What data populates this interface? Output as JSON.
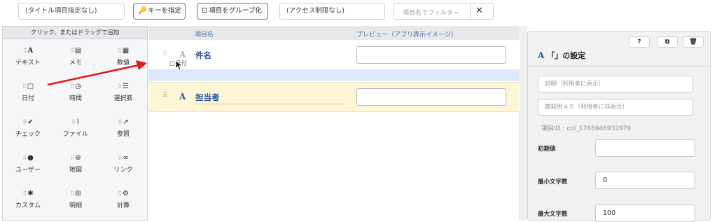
{
  "toolbar": {
    "title_field": "(タイトル項目指定なし)",
    "key_button": "キーを指定",
    "group_button": "項目をグループ化",
    "access_field": "(アクセス制限なし)",
    "filter_placeholder": "項目名でフィルター"
  },
  "palette": {
    "header": "クリック、またはドラッグで追加",
    "items": [
      {
        "label": "テキスト",
        "icon": "A"
      },
      {
        "label": "メモ",
        "icon": "▤"
      },
      {
        "label": "数値",
        "icon": "▦"
      },
      {
        "label": "日付",
        "icon": "▢"
      },
      {
        "label": "時間",
        "icon": "◷"
      },
      {
        "label": "選択肢",
        "icon": "☰"
      },
      {
        "label": "チェック",
        "icon": "✔"
      },
      {
        "label": "ファイル",
        "icon": "⌇"
      },
      {
        "label": "参照",
        "icon": "↗"
      },
      {
        "label": "ユーザー",
        "icon": "●"
      },
      {
        "label": "地図",
        "icon": "⊕"
      },
      {
        "label": "リンク",
        "icon": "∞"
      },
      {
        "label": "カスタム",
        "icon": "✱"
      },
      {
        "label": "明細",
        "icon": "⊞"
      },
      {
        "label": "計算",
        "icon": "⚙"
      }
    ]
  },
  "list": {
    "col_name": "項目名",
    "col_preview": "プレビュー（アプリ表示イメージ）",
    "fields": [
      {
        "type_icon": "A",
        "name": "件名"
      },
      {
        "type_icon": "A",
        "name": "担当者"
      }
    ],
    "drag_ghost_label": "日付"
  },
  "settings": {
    "title": "「」の設定",
    "type_icon": "A",
    "buttons": [
      "?",
      "⧉",
      "🗑"
    ],
    "description_placeholder": "説明（利用者に表示）",
    "dev_memo_placeholder": "開発用メモ（利用者に非表示）",
    "field_id": "項目ID : col_1765946931979",
    "initial_label": "初期値",
    "initial_value": "",
    "min_label": "最小文字数",
    "min_value": "0",
    "max_label": "最大文字数",
    "max_value": "100"
  },
  "colors": {
    "accent": "#2a5596",
    "drop_zone": "#dce9fb",
    "selected_row": "#fdf6d6",
    "arrow": "#e3191f"
  }
}
